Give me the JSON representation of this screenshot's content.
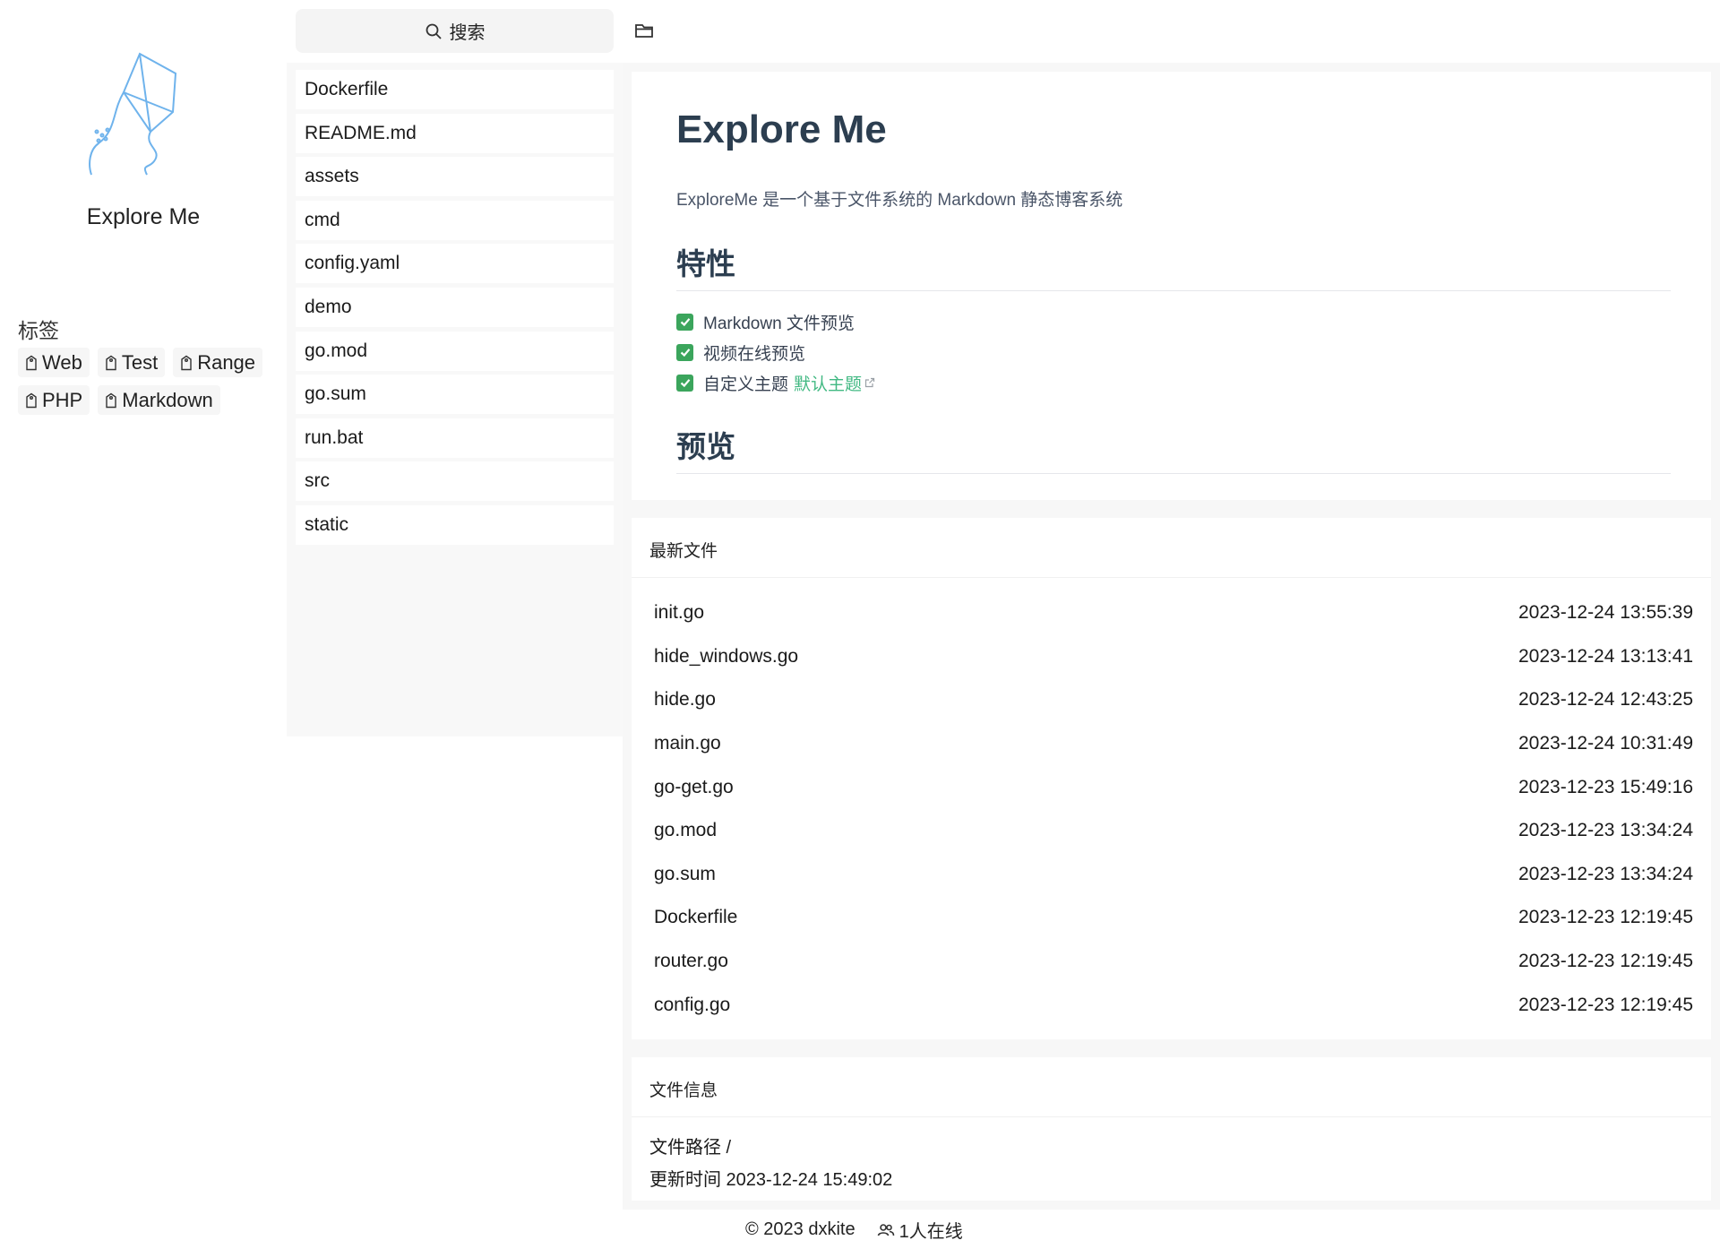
{
  "site": {
    "title": "Explore Me"
  },
  "tags": {
    "title": "标签",
    "items": [
      "Web",
      "Test",
      "Range",
      "PHP",
      "Markdown"
    ]
  },
  "search": {
    "label": "搜索"
  },
  "files": [
    "Dockerfile",
    "README.md",
    "assets",
    "cmd",
    "config.yaml",
    "demo",
    "go.mod",
    "go.sum",
    "run.bat",
    "src",
    "static"
  ],
  "readme": {
    "title": "Explore Me",
    "description": "ExploreMe 是一个基于文件系统的 Markdown 静态博客系统",
    "features_heading": "特性",
    "features": [
      {
        "text": "Markdown 文件预览"
      },
      {
        "text": "视频在线预览"
      },
      {
        "text": "自定义主题",
        "link": "默认主题"
      }
    ],
    "preview_heading": "预览"
  },
  "recent": {
    "title": "最新文件",
    "rows": [
      {
        "name": "init.go",
        "time": "2023-12-24 13:55:39"
      },
      {
        "name": "hide_windows.go",
        "time": "2023-12-24 13:13:41"
      },
      {
        "name": "hide.go",
        "time": "2023-12-24 12:43:25"
      },
      {
        "name": "main.go",
        "time": "2023-12-24 10:31:49"
      },
      {
        "name": "go-get.go",
        "time": "2023-12-23 15:49:16"
      },
      {
        "name": "go.mod",
        "time": "2023-12-23 13:34:24"
      },
      {
        "name": "go.sum",
        "time": "2023-12-23 13:34:24"
      },
      {
        "name": "Dockerfile",
        "time": "2023-12-23 12:19:45"
      },
      {
        "name": "router.go",
        "time": "2023-12-23 12:19:45"
      },
      {
        "name": "config.go",
        "time": "2023-12-23 12:19:45"
      }
    ]
  },
  "info": {
    "title": "文件信息",
    "path": "文件路径 /",
    "updated": "更新时间 2023-12-24 15:49:02"
  },
  "footer": {
    "copyright": "© 2023 dxkite",
    "online": "1人在线"
  },
  "icons": [
    "kite-logo-icon",
    "tag-icon",
    "search-icon",
    "folder-icon",
    "checkbox-checked-icon",
    "external-link-icon",
    "users-icon"
  ],
  "colors": {
    "accent": "#42b983",
    "check": "#3ba55c",
    "logo": "#6fb3ec",
    "heading": "#2c3e50"
  }
}
